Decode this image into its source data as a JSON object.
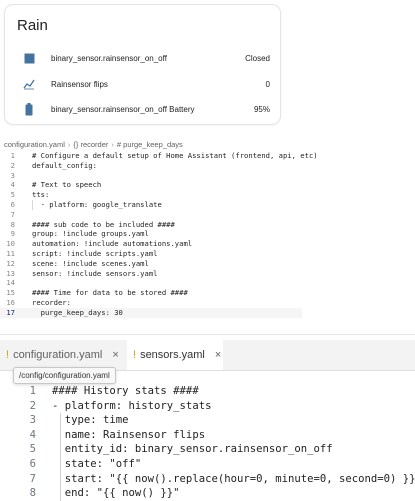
{
  "card": {
    "title": "Rain",
    "rows": [
      {
        "icon": "square-icon",
        "name": "binary_sensor.rainsensor_on_off",
        "state": "Closed"
      },
      {
        "icon": "chart-line-icon",
        "name": "Rainsensor flips",
        "state": "0"
      },
      {
        "icon": "battery-icon",
        "name": "binary_sensor.rainsensor_on_off Battery",
        "state": "95%"
      }
    ],
    "icon_color": "#44739e"
  },
  "editor1": {
    "breadcrumb": [
      "configuration.yaml",
      "{} recorder",
      "# purge_keep_days"
    ],
    "lines": [
      {
        "n": "1",
        "text": "# Configure a default setup of Home Assistant (frontend, api, etc)"
      },
      {
        "n": "2",
        "text": "default_config:"
      },
      {
        "n": "3",
        "text": ""
      },
      {
        "n": "4",
        "text": "# Text to speech"
      },
      {
        "n": "5",
        "text": "tts:"
      },
      {
        "n": "6",
        "text": "  - platform: google_translate"
      },
      {
        "n": "7",
        "text": ""
      },
      {
        "n": "8",
        "text": "#### sub code to be included ####"
      },
      {
        "n": "9",
        "text": "group: !include groups.yaml"
      },
      {
        "n": "10",
        "text": "automation: !include automations.yaml"
      },
      {
        "n": "11",
        "text": "script: !include scripts.yaml"
      },
      {
        "n": "12",
        "text": "scene: !include scenes.yaml"
      },
      {
        "n": "13",
        "text": "sensor: !include sensors.yaml"
      },
      {
        "n": "14",
        "text": ""
      },
      {
        "n": "15",
        "text": "#### Time for data to be stored ####"
      },
      {
        "n": "16",
        "text": "recorder:"
      },
      {
        "n": "17",
        "text": "  purge_keep_days: 30"
      }
    ]
  },
  "editor2": {
    "tabs": [
      {
        "label": "configuration.yaml",
        "close": "×"
      },
      {
        "label": "sensors.yaml",
        "close": "×"
      }
    ],
    "tooltip": "/config/configuration.yaml",
    "lines": [
      {
        "n": "1",
        "text": "#### History stats ####"
      },
      {
        "n": "2",
        "text": "- platform: history_stats"
      },
      {
        "n": "3",
        "text": "  type: time"
      },
      {
        "n": "4",
        "text": "  name: Rainsensor flips"
      },
      {
        "n": "5",
        "text": "  entity_id: binary_sensor.rainsensor_on_off"
      },
      {
        "n": "6",
        "text": "  state: \"off\""
      },
      {
        "n": "7",
        "text": "  start: \"{{ now().replace(hour=0, minute=0, second=0) }}\""
      },
      {
        "n": "8",
        "text": "  end: \"{{ now() }}\""
      }
    ]
  }
}
